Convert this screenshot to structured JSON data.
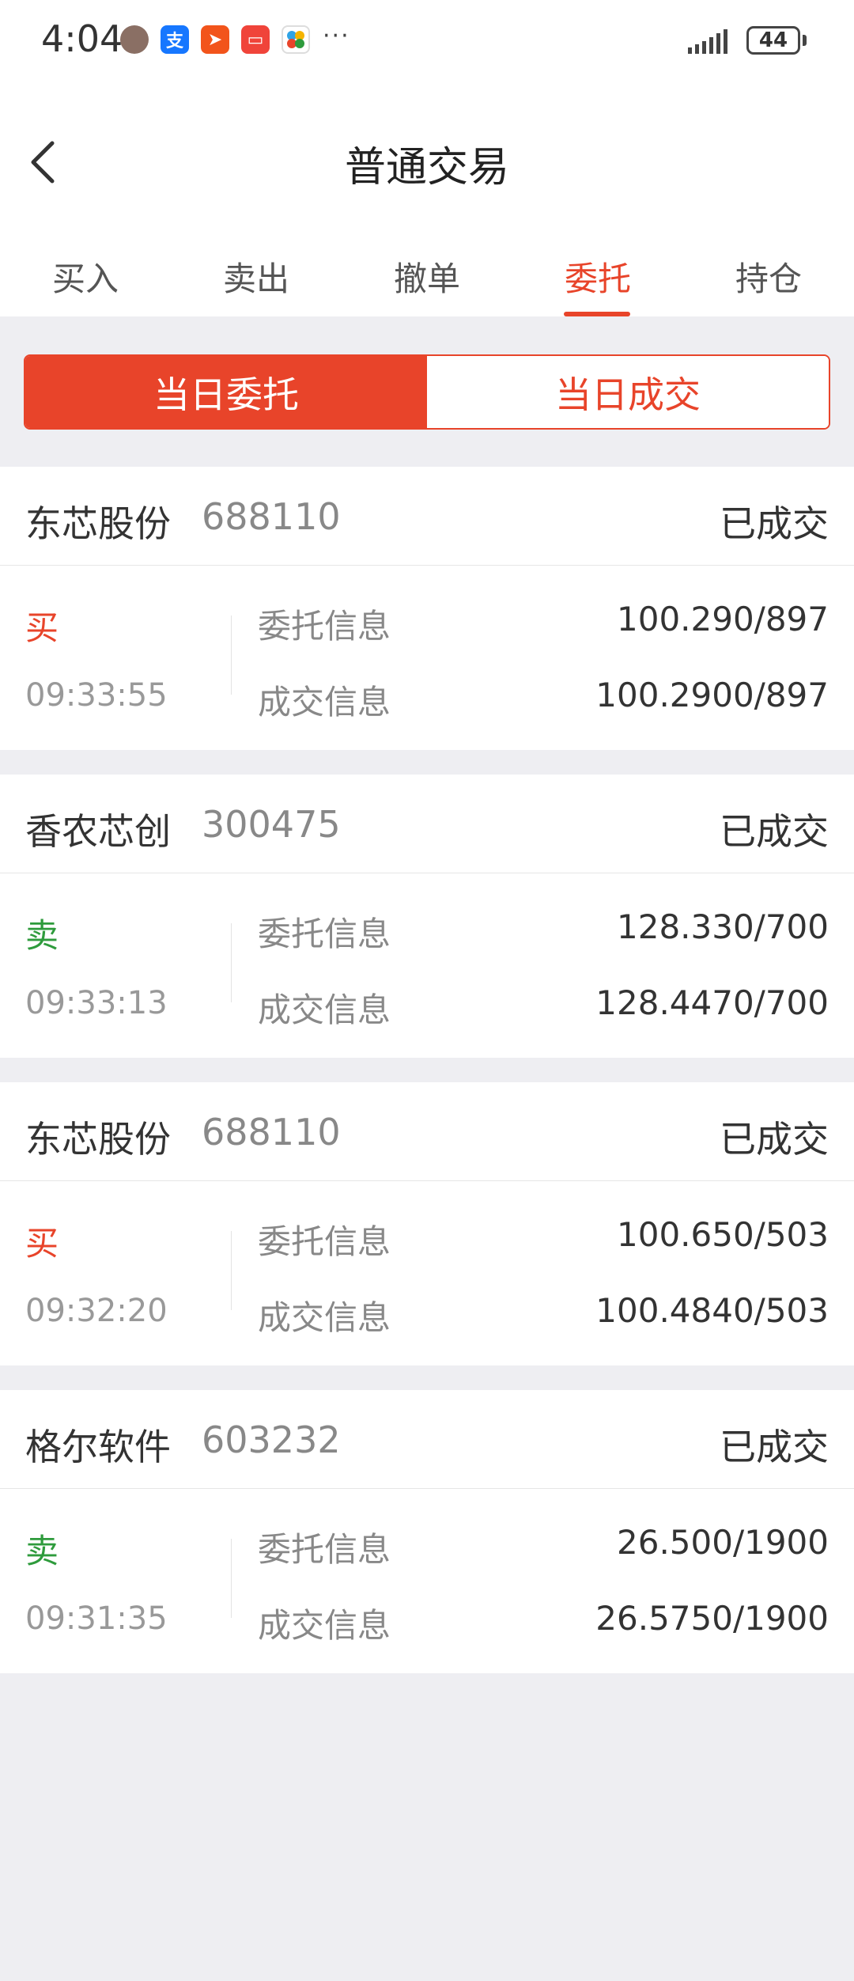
{
  "status_bar": {
    "time": "4:04",
    "battery": "44",
    "dots": "···"
  },
  "header": {
    "title": "普通交易"
  },
  "tabs": [
    {
      "label": "买入"
    },
    {
      "label": "卖出"
    },
    {
      "label": "撤单"
    },
    {
      "label": "委托",
      "active": true
    },
    {
      "label": "持仓"
    }
  ],
  "segment": {
    "active_label": "当日委托",
    "inactive_label": "当日成交"
  },
  "colors": {
    "accent": "#e8442a",
    "sell": "#2e9b3c",
    "background": "#eeeef2"
  },
  "labels": {
    "entrust_info": "委托信息",
    "deal_info": "成交信息"
  },
  "orders": [
    {
      "name": "东芯股份",
      "code": "688110",
      "status": "已成交",
      "side": "买",
      "side_type": "buy",
      "time": "09:33:55",
      "entrust": "100.290/897",
      "deal": "100.2900/897"
    },
    {
      "name": "香农芯创",
      "code": "300475",
      "status": "已成交",
      "side": "卖",
      "side_type": "sell",
      "time": "09:33:13",
      "entrust": "128.330/700",
      "deal": "128.4470/700"
    },
    {
      "name": "东芯股份",
      "code": "688110",
      "status": "已成交",
      "side": "买",
      "side_type": "buy",
      "time": "09:32:20",
      "entrust": "100.650/503",
      "deal": "100.4840/503"
    },
    {
      "name": "格尔软件",
      "code": "603232",
      "status": "已成交",
      "side": "卖",
      "side_type": "sell",
      "time": "09:31:35",
      "entrust": "26.500/1900",
      "deal": "26.5750/1900"
    }
  ]
}
